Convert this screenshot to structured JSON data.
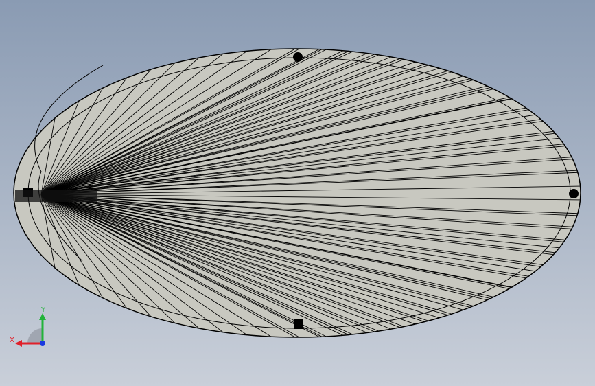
{
  "viewport": {
    "background_top": "#8a9bb3",
    "background_bottom": "#c9cfd9"
  },
  "model": {
    "face_color": "#c8c8c0",
    "edge_color": "#000000",
    "radial_line_count": 64,
    "inner_rim": true
  },
  "triad": {
    "x_label": "X",
    "y_label": "Y",
    "x_color": "#e0202a",
    "y_color": "#22b33a",
    "z_color": "#1a3ae0"
  }
}
